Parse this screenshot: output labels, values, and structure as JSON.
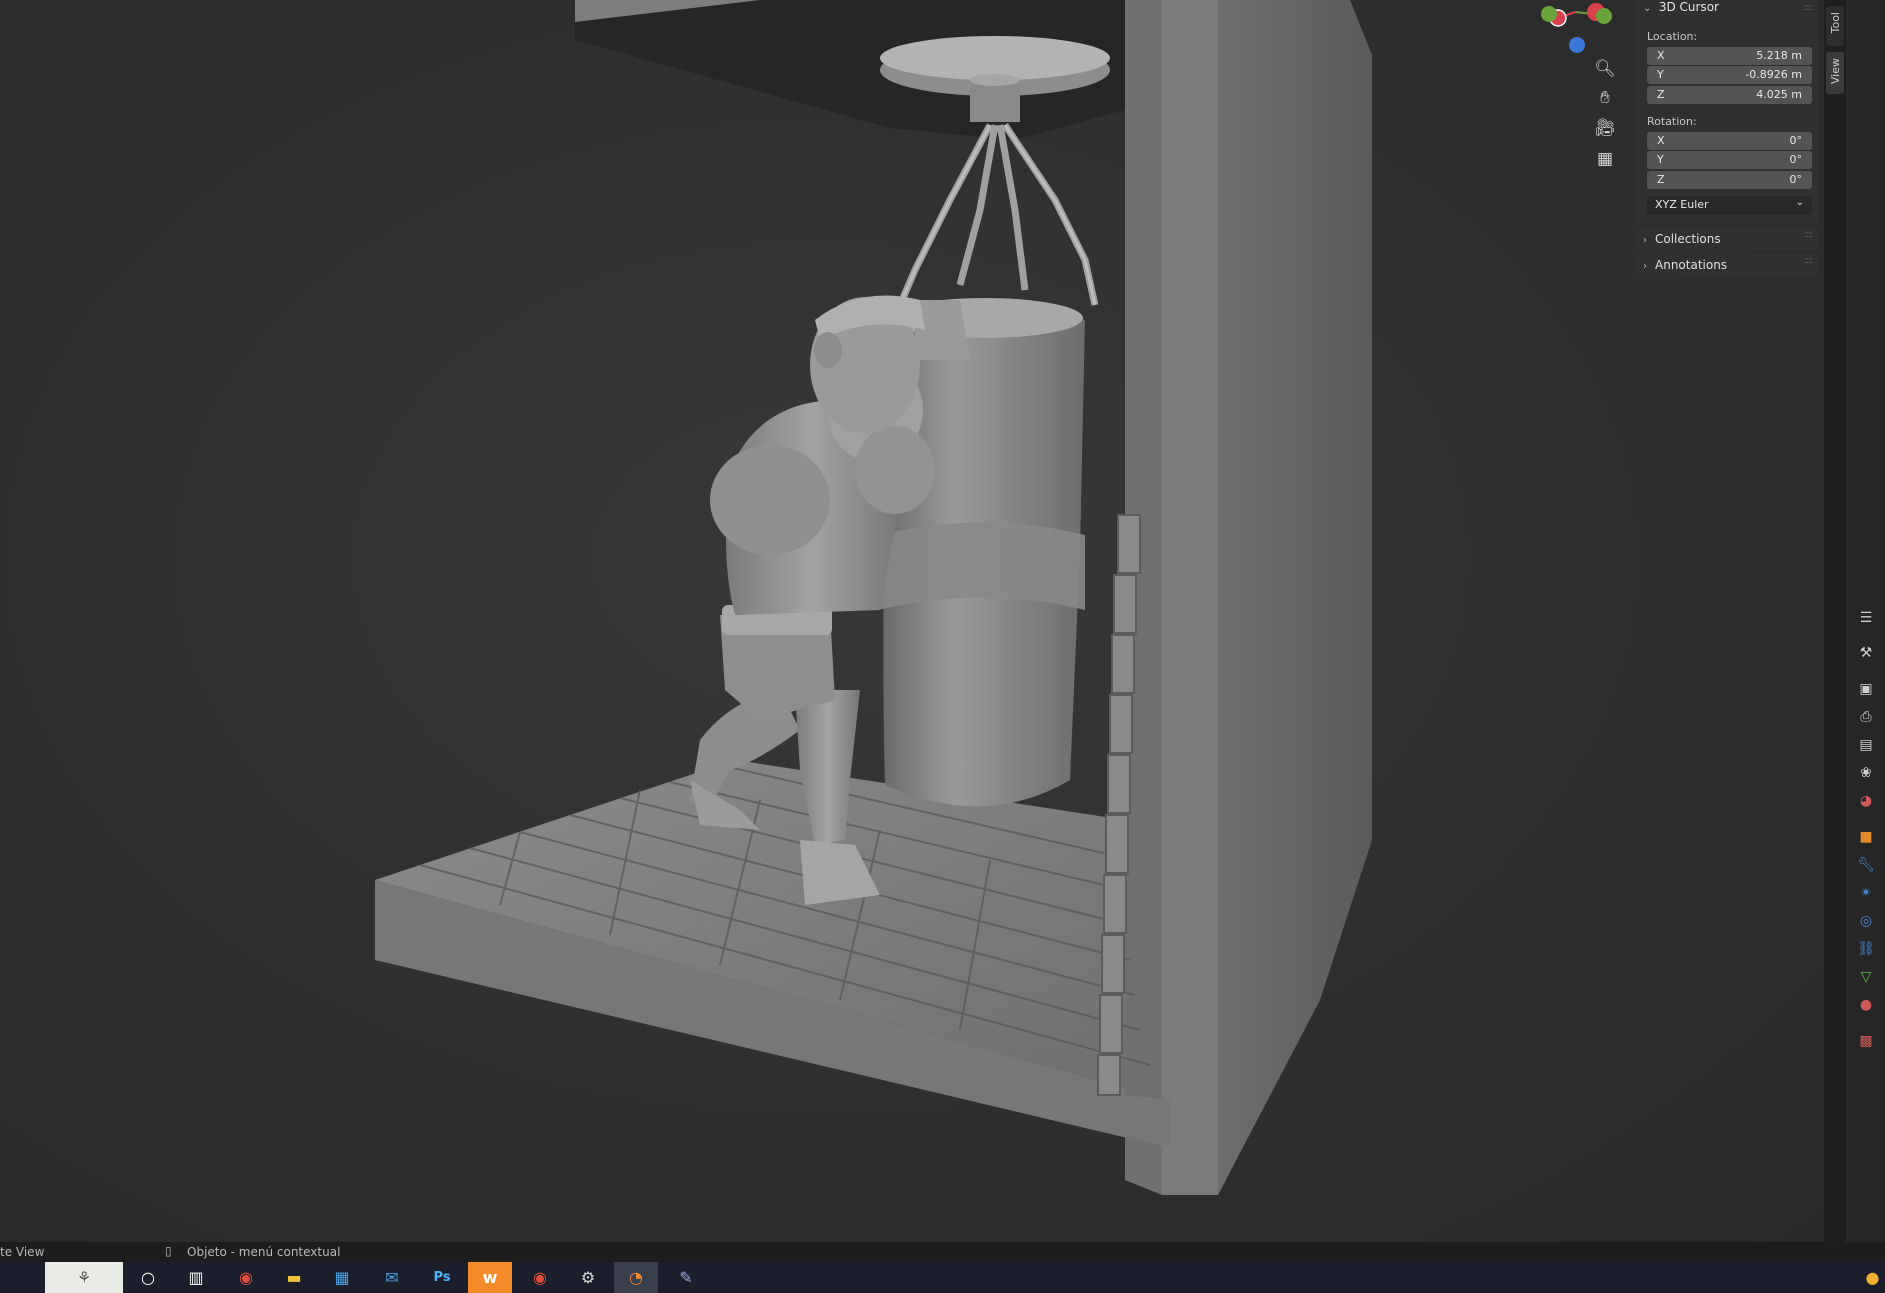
{
  "n_panel": {
    "title": "3D Cursor",
    "location_label": "Location:",
    "location": [
      {
        "axis": "X",
        "value": "5.218 m"
      },
      {
        "axis": "Y",
        "value": "-0.8926 m"
      },
      {
        "axis": "Z",
        "value": "4.025 m"
      }
    ],
    "rotation_label": "Rotation:",
    "rotation": [
      {
        "axis": "X",
        "value": "0°"
      },
      {
        "axis": "Y",
        "value": "0°"
      },
      {
        "axis": "Z",
        "value": "0°"
      }
    ],
    "rotation_mode": "XYZ Euler",
    "collections": "Collections",
    "annotations": "Annotations"
  },
  "side_tabs": {
    "tool": "Tool",
    "view": "View"
  },
  "status_bar": {
    "left": "te View",
    "context": "Objeto - menú contextual"
  },
  "icons": {
    "zoom": "zoom-icon",
    "pan": "hand-icon",
    "camera": "camera-icon",
    "ortho": "grid-icon",
    "mouse": "mouse-icon"
  },
  "colors": {
    "x_axis": "#d8404c",
    "y_axis": "#6aa33a",
    "z_axis": "#3d78d8",
    "panel_bg": "#303030",
    "field_bg": "#545454"
  }
}
